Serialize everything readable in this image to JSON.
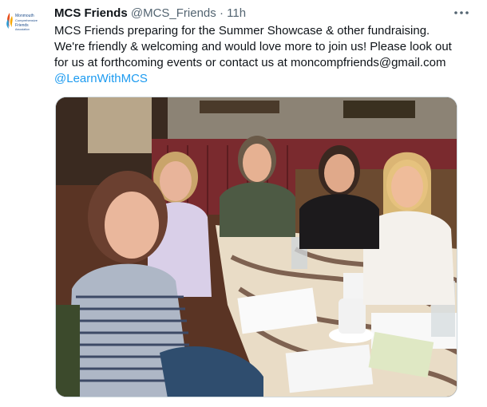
{
  "tweet": {
    "avatar": {
      "org_name_line1": "Monmouth",
      "org_name_line2": "Comprehensive",
      "org_name_line3": "Friends",
      "org_name_line4": "Association",
      "icon": "flame-logo-icon"
    },
    "display_name": "MCS Friends",
    "handle": "@MCS_Friends",
    "separator": "·",
    "time": "11h",
    "more_icon": "more-horizontal-icon",
    "text_lines": [
      "MCS Friends preparing for the Summer Showcase & other fundraising.",
      "We're friendly & welcoming and would love more to join us! Please look out",
      "for us at forthcoming events or contact us at moncompfriends@gmail.com"
    ],
    "mention": "@LearnWithMCS",
    "photo_icon": "photo-image-icon"
  },
  "colors": {
    "link": "#1d9bf0",
    "muted": "#536471",
    "text": "#0f1419"
  }
}
